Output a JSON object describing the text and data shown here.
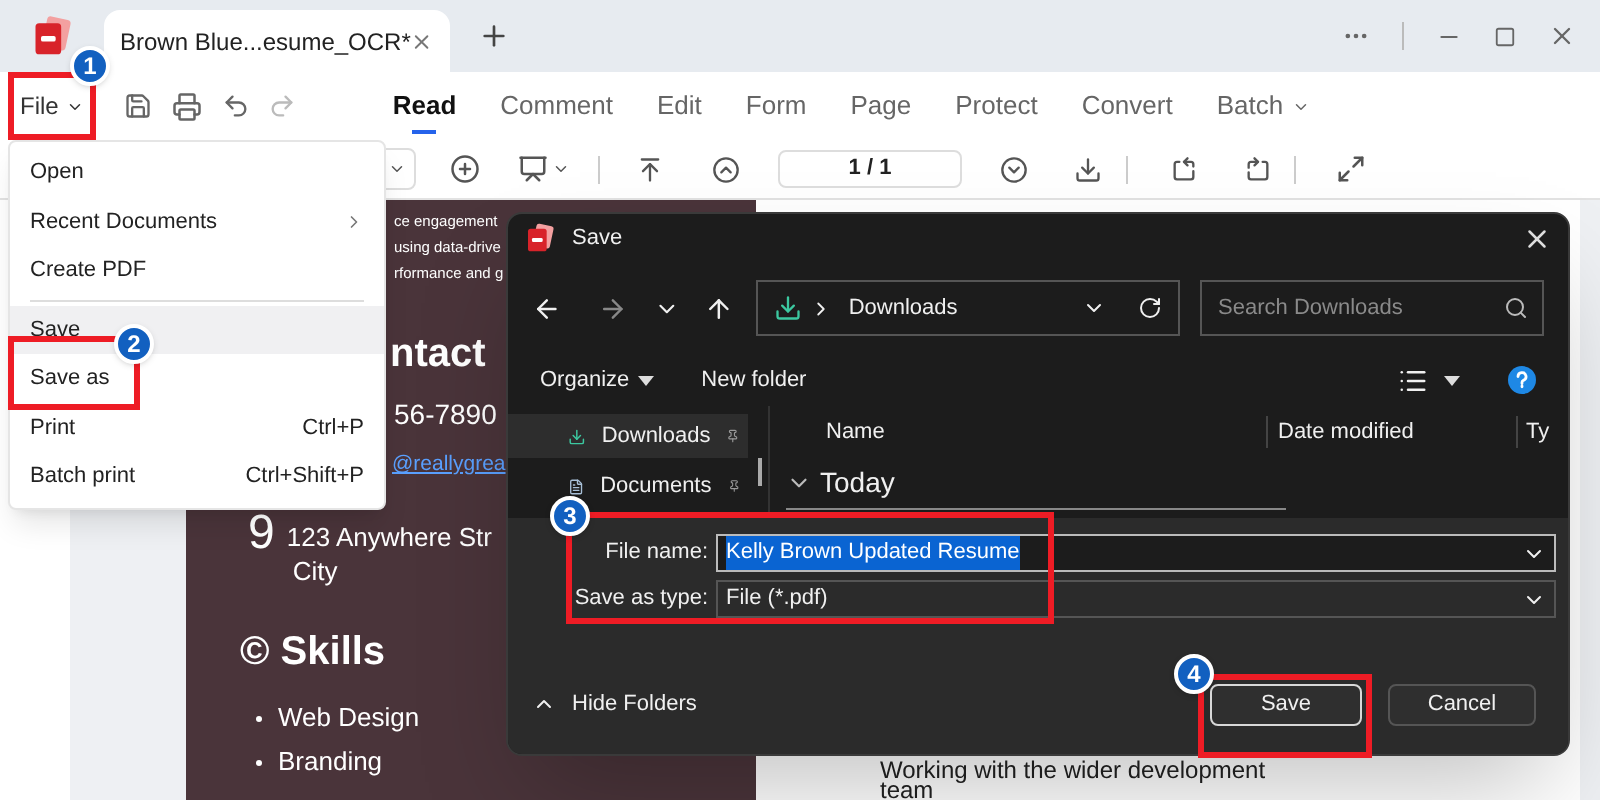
{
  "window": {
    "tab_title": "Brown Blue...esume_OCR*"
  },
  "menu": {
    "file_label": "File",
    "tabs": [
      {
        "label": "Read",
        "selected": true,
        "dropdown": false
      },
      {
        "label": "Comment",
        "selected": false,
        "dropdown": false
      },
      {
        "label": "Edit",
        "selected": false,
        "dropdown": false
      },
      {
        "label": "Form",
        "selected": false,
        "dropdown": false
      },
      {
        "label": "Page",
        "selected": false,
        "dropdown": false
      },
      {
        "label": "Protect",
        "selected": false,
        "dropdown": false
      },
      {
        "label": "Convert",
        "selected": false,
        "dropdown": false
      },
      {
        "label": "Batch",
        "selected": false,
        "dropdown": true
      }
    ]
  },
  "toolbar": {
    "page_field": "1 / 1"
  },
  "file_menu": [
    {
      "kind": "item",
      "label": "Open",
      "highlighted": false,
      "submenu": false
    },
    {
      "kind": "item",
      "label": "Recent Documents",
      "highlighted": false,
      "submenu": true
    },
    {
      "kind": "item",
      "label": "Create PDF",
      "highlighted": false,
      "submenu": false
    },
    {
      "kind": "divider"
    },
    {
      "kind": "item",
      "label": "Save",
      "highlighted": true,
      "submenu": false
    },
    {
      "kind": "item",
      "label": "Save as",
      "highlighted": false,
      "submenu": false
    },
    {
      "kind": "item",
      "label": "Print",
      "shortcut": "Ctrl+P",
      "highlighted": false,
      "submenu": false
    },
    {
      "kind": "item",
      "label": "Batch print",
      "shortcut": "Ctrl+Shift+P",
      "highlighted": false,
      "submenu": false
    }
  ],
  "document": {
    "intro_lines": [
      "ce engagement",
      "using data-drive",
      "rformance and g"
    ],
    "contact_heading": "ntact",
    "phone": "56-7890",
    "email": "@reallygrea",
    "address_mark": "9",
    "address": [
      "123 Anywhere Str",
      "City"
    ],
    "skills_heading": "© Skills",
    "skills": [
      "Web Design",
      "Branding"
    ],
    "body_lines": [
      "Working with the wider development",
      "team"
    ]
  },
  "dialog": {
    "title": "Save",
    "location": "Downloads",
    "search": {
      "placeholder": "Search Downloads"
    },
    "commands": [
      {
        "label": "Organize",
        "dropdown": true
      },
      {
        "label": "New folder",
        "dropdown": false
      }
    ],
    "nav": [
      {
        "label": "Downloads",
        "selected": true,
        "kind": "download"
      },
      {
        "label": "Documents",
        "selected": false,
        "kind": "documents"
      }
    ],
    "columns": [
      "Name",
      "Date modified",
      "Ty"
    ],
    "group": "Today",
    "file_name": {
      "label": "File name:",
      "value": "Kelly Brown Updated Resume",
      "value_selected": true
    },
    "file_type": {
      "label": "Save as type:",
      "value": "File (*.pdf)"
    },
    "hide_folders": "Hide Folders",
    "buttons": [
      {
        "label": "Save",
        "default": true
      },
      {
        "label": "Cancel",
        "default": false
      }
    ]
  },
  "annotations": [
    {
      "number": "1"
    },
    {
      "number": "2"
    },
    {
      "number": "3"
    },
    {
      "number": "4"
    }
  ]
}
